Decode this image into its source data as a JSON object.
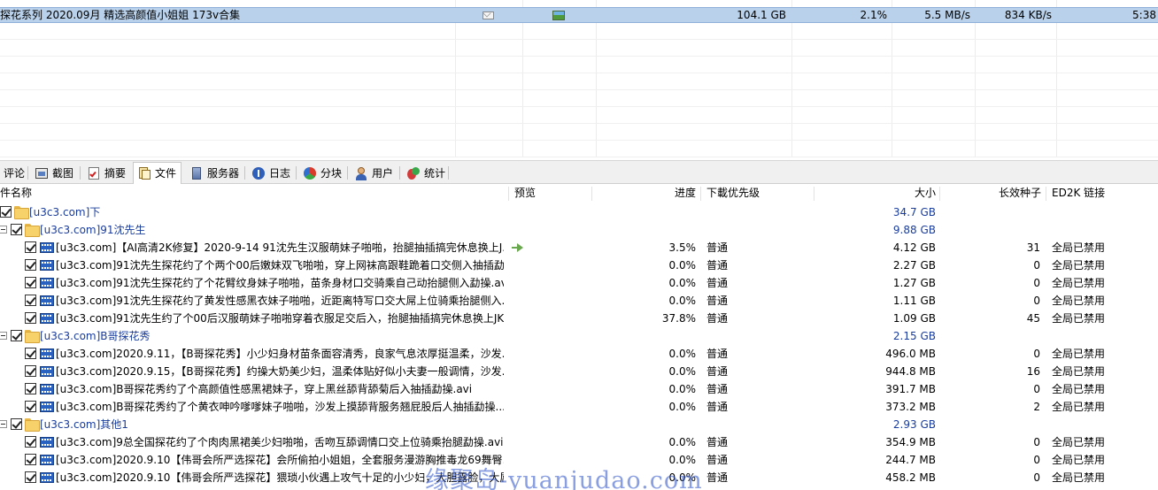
{
  "download_list": {
    "selected_row": {
      "name": "探花系列 2020.09月 精选高颜值小姐姐 173v合集",
      "comment_icon": "envelope-icon",
      "preview_icon": "image-preview-icon",
      "size": "104.1 GB",
      "progress": "2.1%",
      "download_speed": "5.5 MB/s",
      "upload_speed": "834 KB/s",
      "time_left": "5:38"
    }
  },
  "tabs": [
    {
      "label": "评论",
      "icon": "comment-icon"
    },
    {
      "label": "截图",
      "icon": "screenshot-icon"
    },
    {
      "label": "摘要",
      "icon": "summary-icon"
    },
    {
      "label": "文件",
      "icon": "files-icon",
      "active": true
    },
    {
      "label": "服务器",
      "icon": "server-icon"
    },
    {
      "label": "日志",
      "icon": "log-icon"
    },
    {
      "label": "分块",
      "icon": "chunks-icon"
    },
    {
      "label": "用户",
      "icon": "users-icon"
    },
    {
      "label": "统计",
      "icon": "stats-icon"
    }
  ],
  "file_tree": {
    "columns": {
      "name": "件名称",
      "preview": "预览",
      "progress": "进度",
      "priority": "下載优先级",
      "size": "大小",
      "seeds": "长效种子",
      "ed2k": "ED2K 链接"
    },
    "rows": [
      {
        "type": "folder",
        "level": 0,
        "expander": false,
        "name": "[u3c3.com]下",
        "size": "34.7 GB"
      },
      {
        "type": "folder",
        "level": 1,
        "expander": true,
        "name": "[u3c3.com]91沈先生",
        "size": "9.88 GB"
      },
      {
        "type": "file",
        "level": 2,
        "name": "[u3c3.com]【AI高清2K修复】2020-9-14 91沈先生汉服萌妹子啪啪，抬腿抽插搞完休息换上J...",
        "preview": true,
        "progress": "3.5%",
        "priority": "普通",
        "size": "4.12 GB",
        "seeds": "31",
        "ed2k": "全局已禁用"
      },
      {
        "type": "file",
        "level": 2,
        "name": "[u3c3.com]91沈先生探花约了个两个00后嫩妹双飞啪啪，穿上网袜高跟鞋跪着口交侧入抽插勐...",
        "progress": "0.0%",
        "priority": "普通",
        "size": "2.27 GB",
        "seeds": "0",
        "ed2k": "全局已禁用"
      },
      {
        "type": "file",
        "level": 2,
        "name": "[u3c3.com]91沈先生探花约了个花臂纹身妹子啪啪，苗条身材口交骑乘自己动抬腿侧入勐操.avi",
        "progress": "0.0%",
        "priority": "普通",
        "size": "1.27 GB",
        "seeds": "0",
        "ed2k": "全局已禁用"
      },
      {
        "type": "file",
        "level": 2,
        "name": "[u3c3.com]91沈先生探花约了黄发性感黑衣妹子啪啪，近距离特写口交大屌上位骑乘抬腿侧入...",
        "progress": "0.0%",
        "priority": "普通",
        "size": "1.11 GB",
        "seeds": "0",
        "ed2k": "全局已禁用"
      },
      {
        "type": "file",
        "level": 2,
        "name": "[u3c3.com]91沈先生约了个00后汉服萌妹子啪啪穿着衣服足交后入，抬腿抽插搞完休息换上JK...",
        "progress": "37.8%",
        "priority": "普通",
        "size": "1.09 GB",
        "seeds": "45",
        "ed2k": "全局已禁用"
      },
      {
        "type": "folder",
        "level": 1,
        "expander": true,
        "name": "[u3c3.com]B哥探花秀",
        "size": "2.15 GB"
      },
      {
        "type": "file",
        "level": 2,
        "name": "[u3c3.com]2020.9.11，【B哥探花秀】小少妇身材苗条面容清秀，良家气息浓厚挺温柔，沙发...",
        "progress": "0.0%",
        "priority": "普通",
        "size": "496.0 MB",
        "seeds": "0",
        "ed2k": "全局已禁用"
      },
      {
        "type": "file",
        "level": 2,
        "name": "[u3c3.com]2020.9.15，【B哥探花秀】约操大奶美少妇，温柔体贴好似小夫妻一般调情，沙发...",
        "progress": "0.0%",
        "priority": "普通",
        "size": "944.8 MB",
        "seeds": "16",
        "ed2k": "全局已禁用"
      },
      {
        "type": "file",
        "level": 2,
        "name": "[u3c3.com]B哥探花秀约了个高颜值性感黑裙妹子，穿上黑丝舔背舔菊后入抽插勐操.avi",
        "progress": "0.0%",
        "priority": "普通",
        "size": "391.7 MB",
        "seeds": "0",
        "ed2k": "全局已禁用"
      },
      {
        "type": "file",
        "level": 2,
        "name": "[u3c3.com]B哥探花秀约了个黄衣呻吟嗲嗲妹子啪啪，沙发上摸舔背服务翘屁股后人抽插勐操...",
        "progress": "0.0%",
        "priority": "普通",
        "size": "373.2 MB",
        "seeds": "2",
        "ed2k": "全局已禁用"
      },
      {
        "type": "folder",
        "level": 1,
        "expander": true,
        "name": "[u3c3.com]其他1",
        "size": "2.93 GB"
      },
      {
        "type": "file",
        "level": 2,
        "name": "[u3c3.com]9总全国探花约了个肉肉黑裙美少妇啪啪，舌吻互舔调情口交上位骑乘抬腿勐操.avi",
        "progress": "0.0%",
        "priority": "普通",
        "size": "354.9 MB",
        "seeds": "0",
        "ed2k": "全局已禁用"
      },
      {
        "type": "file",
        "level": 2,
        "name": "[u3c3.com]2020.9.10【伟哥会所严选探花】会所偷拍小姐姐，全套服务漫游胸推毒龙69舞臀...",
        "progress": "0.0%",
        "priority": "普通",
        "size": "244.7 MB",
        "seeds": "0",
        "ed2k": "全局已禁用"
      },
      {
        "type": "file",
        "level": 2,
        "name": "[u3c3.com]2020.9.10【伟哥会所严选探花】猥琐小伙遇上攻气十足的小少妇，大胆露脸，大屌...",
        "progress": "0.0%",
        "priority": "普通",
        "size": "458.2 MB",
        "seeds": "0",
        "ed2k": "全局已禁用"
      }
    ]
  },
  "watermark": "缘聚岛-yuanjudao.com"
}
